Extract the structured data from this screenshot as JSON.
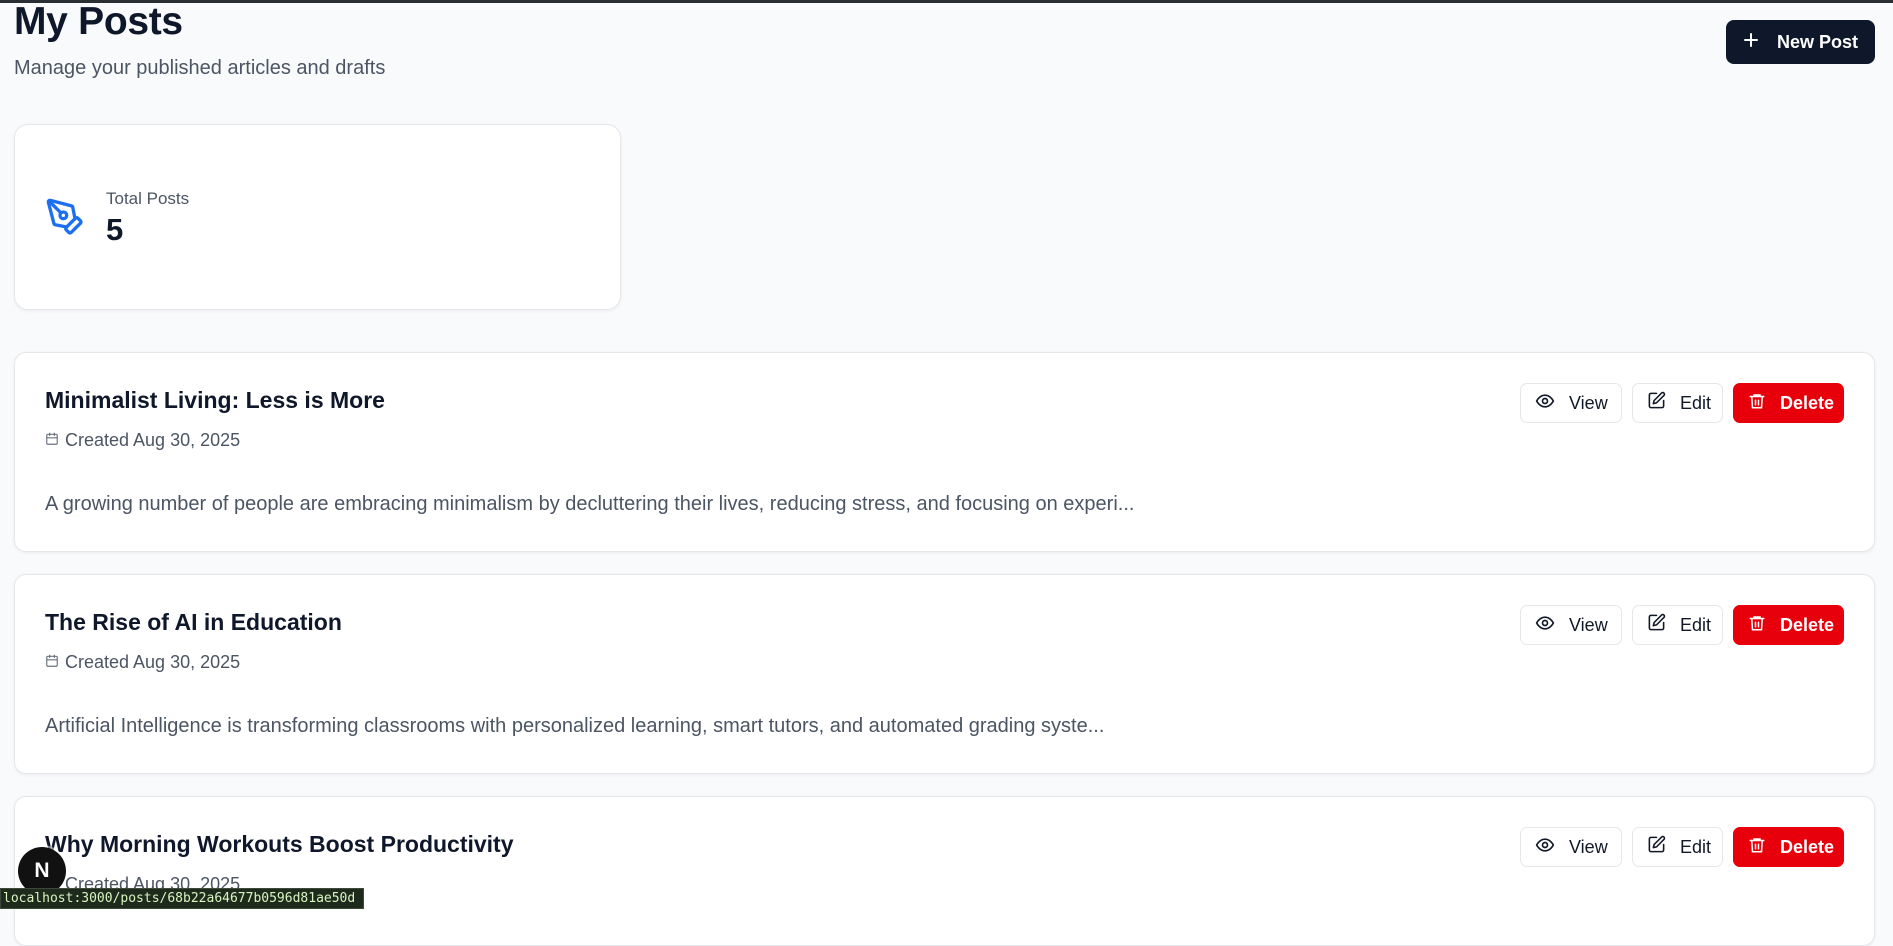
{
  "header": {
    "title": "My Posts",
    "subtitle": "Manage your published articles and drafts",
    "new_post_label": "New Post"
  },
  "stats": {
    "total_label": "Total Posts",
    "total_value": "5"
  },
  "posts": [
    {
      "title": "Minimalist Living: Less is More",
      "date": "Created Aug 30, 2025",
      "excerpt": "A growing number of people are embracing minimalism by decluttering their lives, reducing stress, and focusing on experi..."
    },
    {
      "title": "The Rise of AI in Education",
      "date": "Created Aug 30, 2025",
      "excerpt": "Artificial Intelligence is transforming classrooms with personalized learning, smart tutors, and automated grading syste..."
    },
    {
      "title": "Why Morning Workouts Boost Productivity",
      "date": "Created Aug 30, 2025",
      "excerpt": ""
    }
  ],
  "actions": {
    "view_label": "View",
    "edit_label": "Edit",
    "delete_label": "Delete"
  },
  "dev_badge": {
    "letter": "N"
  },
  "status_bar": {
    "url": "localhost:3000/posts/68b22a64677b0596d81ae50d"
  },
  "colors": {
    "primary": "#0f172a",
    "danger": "#e7000b",
    "accent_icon": "#1d6ff2",
    "background": "#f9fafb"
  },
  "icons": {
    "new_post": "plus-icon",
    "stat": "pen-tool-icon",
    "date": "calendar-icon",
    "view": "eye-icon",
    "edit": "edit-icon",
    "delete": "trash-icon"
  }
}
